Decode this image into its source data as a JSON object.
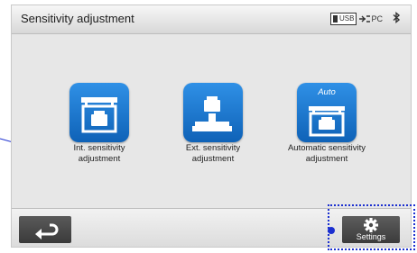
{
  "header": {
    "title": "Sensitivity adjustment",
    "usb_label": "USB",
    "pc_label": "PC",
    "icons": [
      "usb-icon",
      "pc-connection-icon",
      "bluetooth-icon"
    ]
  },
  "main": {
    "buttons": [
      {
        "label_line1": "Int. sensitivity",
        "label_line2": "adjustment",
        "icon": "internal-weight-icon"
      },
      {
        "label_line1": "Ext. sensitivity",
        "label_line2": "adjustment",
        "icon": "external-weight-icon"
      },
      {
        "label_line1": "Automatic sensitivity",
        "label_line2": "adjustment",
        "icon": "auto-weight-icon",
        "badge": "Auto"
      }
    ]
  },
  "footer": {
    "back_icon": "return-arrow-icon",
    "settings_label": "Settings",
    "settings_icon": "gear-icon"
  },
  "colors": {
    "button_blue": "#1a74d0",
    "annotation_blue": "#1b2fd0"
  }
}
